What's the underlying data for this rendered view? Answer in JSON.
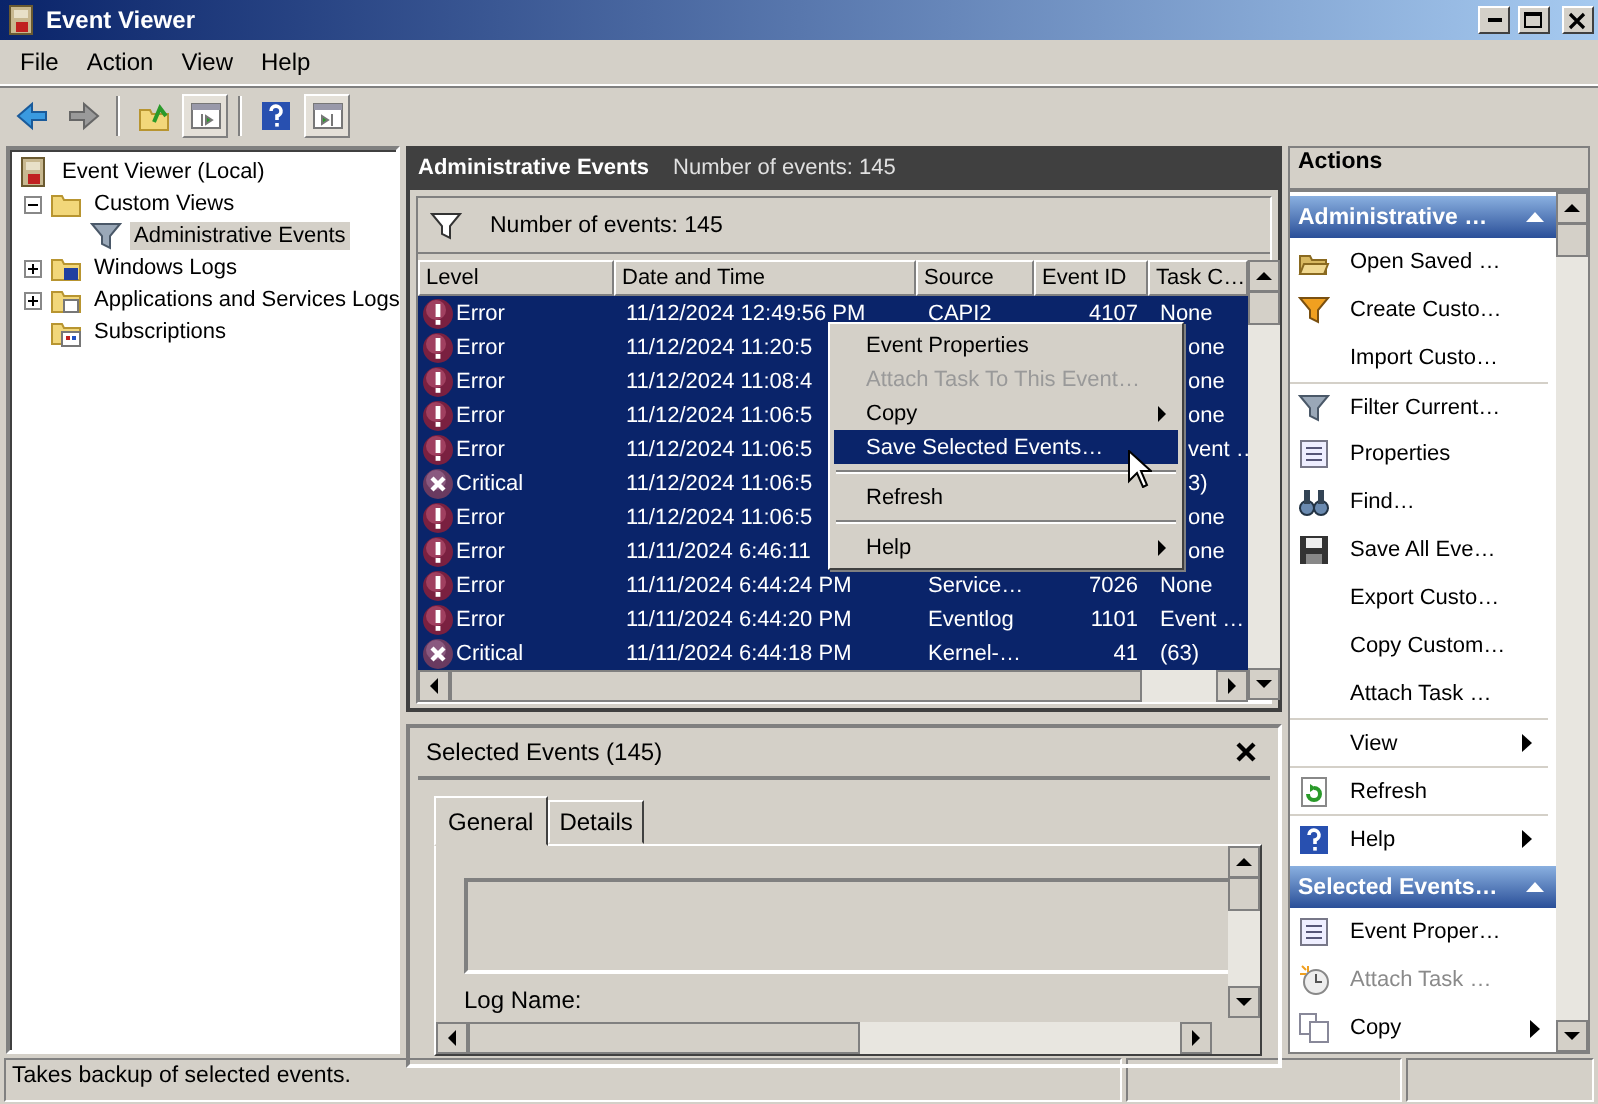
{
  "window": {
    "title": "Event Viewer"
  },
  "menu_bar": [
    {
      "label": "File"
    },
    {
      "label": "Action"
    },
    {
      "label": "View"
    },
    {
      "label": "Help"
    }
  ],
  "tree": [
    {
      "label": "Event Viewer (Local)",
      "kind": "root",
      "selected": false,
      "children": [
        {
          "label": "Custom Views",
          "kind": "folder",
          "expanded": true,
          "selected": false,
          "children": [
            {
              "label": "Administrative Events",
              "kind": "filter",
              "selected": true
            }
          ]
        },
        {
          "label": "Windows Logs",
          "kind": "logs",
          "expanded": false,
          "selected": false
        },
        {
          "label": "Applications and Services Logs",
          "kind": "apps",
          "expanded": false,
          "selected": false
        },
        {
          "label": "Subscriptions",
          "kind": "subscriptions",
          "selected": false
        }
      ]
    }
  ],
  "main": {
    "title": "Administrative Events",
    "subtitle": "Number of events: 145",
    "filter_text": "Number of events: 145",
    "table": {
      "columns": [
        "Level",
        "Date and Time",
        "Source",
        "Event ID",
        "Task C…"
      ],
      "rows": [
        {
          "kind": "error",
          "level": "Error",
          "date": "11/12/2024 12:49:56 PM",
          "source": "CAPI2",
          "event_id": "4107",
          "task": "None",
          "selected": true
        },
        {
          "kind": "error",
          "level": "Error",
          "date": "11/12/2024 11:20:5",
          "task": "one",
          "selected": true
        },
        {
          "kind": "error",
          "level": "Error",
          "date": "11/12/2024 11:08:4",
          "task": "one",
          "selected": true
        },
        {
          "kind": "error",
          "level": "Error",
          "date": "11/12/2024 11:06:5",
          "task": "one",
          "selected": true
        },
        {
          "kind": "error",
          "level": "Error",
          "date": "11/12/2024 11:06:5",
          "task": "vent …",
          "selected": true
        },
        {
          "kind": "critical",
          "level": "Critical",
          "date": "11/12/2024 11:06:5",
          "task": "3)",
          "selected": true
        },
        {
          "kind": "error",
          "level": "Error",
          "date": "11/12/2024 11:06:5",
          "task": "one",
          "selected": true
        },
        {
          "kind": "error",
          "level": "Error",
          "date": "11/11/2024 6:46:11",
          "task": "one",
          "selected": true
        },
        {
          "kind": "error",
          "level": "Error",
          "date": "11/11/2024 6:44:24 PM",
          "source": "Service…",
          "event_id": "7026",
          "task": "None",
          "selected": true
        },
        {
          "kind": "error",
          "level": "Error",
          "date": "11/11/2024 6:44:20 PM",
          "source": "Eventlog",
          "event_id": "1101",
          "task": "Event …",
          "selected": true
        },
        {
          "kind": "critical",
          "level": "Critical",
          "date": "11/11/2024 6:44:18 PM",
          "source": "Kernel-…",
          "event_id": "41",
          "task": "(63)",
          "selected": true
        }
      ]
    }
  },
  "context_menu": {
    "items": [
      {
        "kind": "item",
        "label": "Event Properties",
        "disabled": false,
        "submenu": false,
        "selected": false
      },
      {
        "kind": "item",
        "label": "Attach Task To This Event…",
        "disabled": true,
        "submenu": false,
        "selected": false
      },
      {
        "kind": "item",
        "label": "Copy",
        "disabled": false,
        "submenu": true,
        "selected": false
      },
      {
        "kind": "item",
        "label": "Save Selected Events…",
        "disabled": false,
        "submenu": false,
        "selected": true
      },
      {
        "kind": "separator"
      },
      {
        "kind": "item",
        "label": "Refresh",
        "disabled": false,
        "submenu": false,
        "selected": false
      },
      {
        "kind": "separator"
      },
      {
        "kind": "item",
        "label": "Help",
        "disabled": false,
        "submenu": true,
        "selected": false
      }
    ]
  },
  "details": {
    "title": "Selected Events (145)",
    "tabs": [
      {
        "label": "General",
        "selected": true
      },
      {
        "label": "Details",
        "selected": false
      }
    ],
    "field_label": "Log Name:"
  },
  "actions": {
    "title": "Actions",
    "sections": [
      {
        "title": "Administrative …",
        "expanded": true,
        "items": [
          {
            "kind": "open",
            "label": "Open Saved …",
            "disabled": false,
            "submenu": false
          },
          {
            "kind": "create-filter",
            "label": "Create Custo…",
            "disabled": false,
            "submenu": false
          },
          {
            "kind": "plain",
            "label": "Import Custo…",
            "disabled": false,
            "submenu": false
          },
          {
            "kind": "filter",
            "label": "Filter Current…",
            "disabled": false,
            "submenu": false,
            "divider": true
          },
          {
            "kind": "properties",
            "label": "Properties",
            "disabled": false,
            "submenu": false
          },
          {
            "kind": "find",
            "label": "Find…",
            "disabled": false,
            "submenu": false
          },
          {
            "kind": "save",
            "label": "Save All Eve…",
            "disabled": false,
            "submenu": false
          },
          {
            "kind": "plain",
            "label": "Export Custo…",
            "disabled": false,
            "submenu": false
          },
          {
            "kind": "plain",
            "label": "Copy Custom…",
            "disabled": false,
            "submenu": false
          },
          {
            "kind": "plain",
            "label": "Attach Task …",
            "disabled": false,
            "submenu": false
          },
          {
            "kind": "plain",
            "label": "View",
            "disabled": false,
            "submenu": true,
            "divider": true
          },
          {
            "kind": "refresh",
            "label": "Refresh",
            "disabled": false,
            "submenu": false,
            "divider": true
          },
          {
            "kind": "help",
            "label": "Help",
            "disabled": false,
            "submenu": true,
            "divider": true
          }
        ]
      },
      {
        "title": "Selected Events…",
        "expanded": true,
        "items": [
          {
            "kind": "properties",
            "label": "Event Proper…",
            "disabled": false,
            "submenu": false
          },
          {
            "kind": "clock",
            "label": "Attach Task …",
            "disabled": true,
            "submenu": false
          },
          {
            "kind": "copy",
            "label": "Copy",
            "disabled": false,
            "submenu": true
          }
        ]
      }
    ]
  },
  "status_bar": {
    "text": "Takes backup of selected events."
  }
}
